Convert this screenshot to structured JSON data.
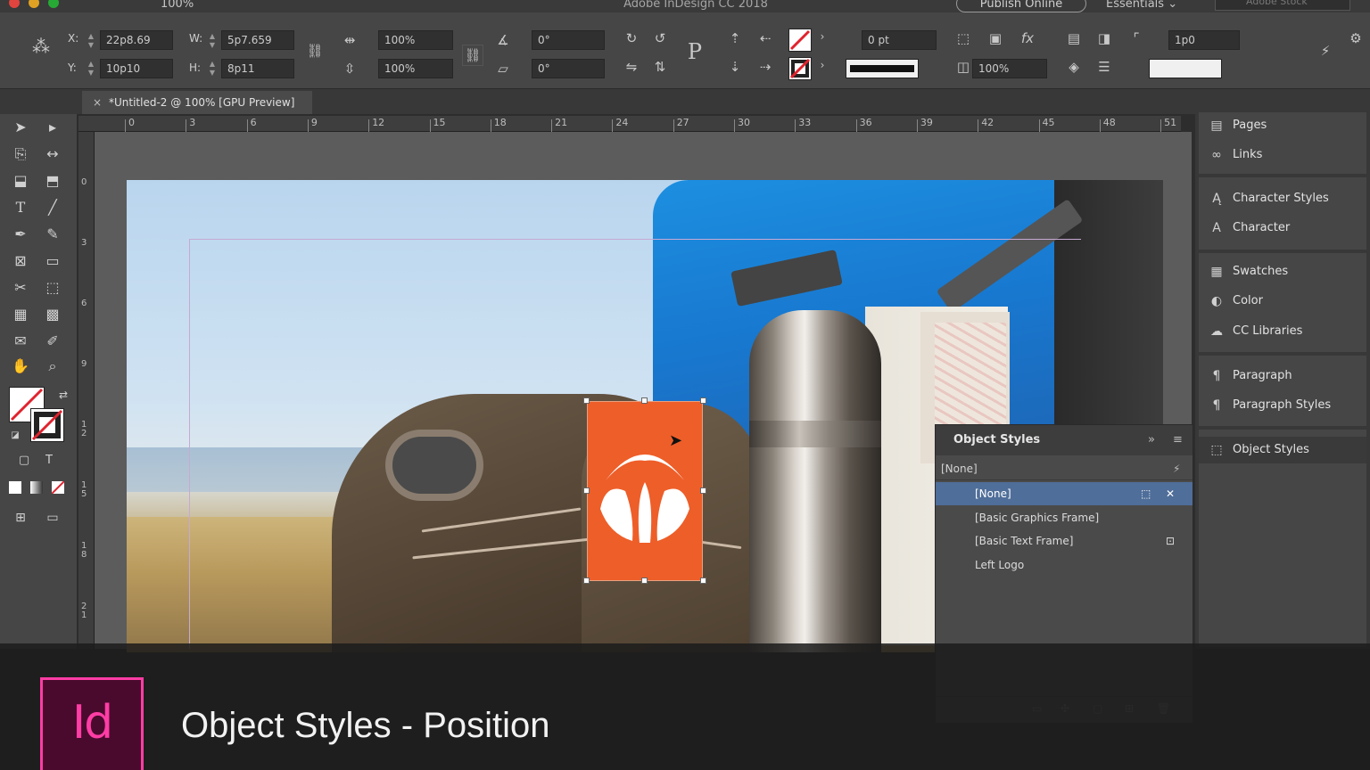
{
  "menubar": {
    "app_title": "Adobe InDesign CC 2018",
    "zoom": "100%",
    "publish_label": "Publish Online",
    "workspace_label": "Essentials",
    "search_placeholder": "Adobe Stock"
  },
  "control_bar": {
    "x_label": "X:",
    "x_value": "22p8.69",
    "y_label": "Y:",
    "y_value": "10p10",
    "w_label": "W:",
    "w_value": "5p7.659",
    "h_label": "H:",
    "h_value": "8p11",
    "scale_x": "100%",
    "scale_y": "100%",
    "rotate": "0°",
    "shear": "0°",
    "stroke_weight": "0 pt",
    "opacity": "100%",
    "corner_size": "1p0"
  },
  "document_tab": {
    "title": "*Untitled-2 @ 100% [GPU Preview]",
    "close_glyph": "×"
  },
  "ruler": {
    "h_marks": [
      "0",
      "3",
      "6",
      "9",
      "12",
      "15",
      "18",
      "21",
      "24",
      "27",
      "30",
      "33",
      "36",
      "39",
      "42",
      "45",
      "48",
      "51"
    ],
    "v_marks": [
      "0",
      "3",
      "6",
      "9",
      "1\n2",
      "1\n5",
      "1\n8",
      "2\n1"
    ]
  },
  "object_styles_panel": {
    "title": "Object Styles",
    "current": "[None]",
    "items": [
      "[None]",
      "[Basic Graphics Frame]",
      "[Basic Text Frame]",
      "Left Logo"
    ],
    "selected_index": 0
  },
  "dock": {
    "items": [
      {
        "label": "Pages",
        "icon": "pages-icon"
      },
      {
        "label": "Links",
        "icon": "links-icon"
      },
      {
        "label": "Character Styles",
        "icon": "character-styles-icon"
      },
      {
        "label": "Character",
        "icon": "character-icon"
      },
      {
        "label": "Swatches",
        "icon": "swatches-icon"
      },
      {
        "label": "Color",
        "icon": "color-icon"
      },
      {
        "label": "CC Libraries",
        "icon": "cc-libraries-icon"
      },
      {
        "label": "Paragraph",
        "icon": "paragraph-icon"
      },
      {
        "label": "Paragraph Styles",
        "icon": "paragraph-styles-icon"
      },
      {
        "label": "Object Styles",
        "icon": "object-styles-icon"
      }
    ]
  },
  "lower_third": {
    "logo_text": "Id",
    "caption": "Object Styles - Position"
  },
  "colors": {
    "accent_pink": "#ff3da5",
    "logo_orange": "#ee5e29",
    "selection_blue": "#4f6e99"
  }
}
